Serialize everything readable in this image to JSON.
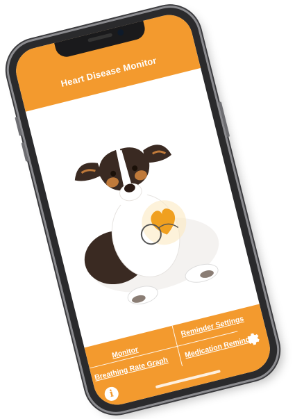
{
  "app": {
    "title": "Heart Disease Monitor"
  },
  "menu": {
    "reminder_settings": "Reminder Settings",
    "monitor": "Monitor",
    "medication_reminder": "Medication Reminder",
    "breathing_rate_graph": "Breathing Rate Graph"
  },
  "icons": {
    "settings": "gear-icon",
    "info": "info-icon"
  },
  "info_glyph": "i",
  "colors": {
    "accent": "#f39a2e",
    "heart": "#f0a020",
    "phone_frame": "#2a2a2c"
  }
}
